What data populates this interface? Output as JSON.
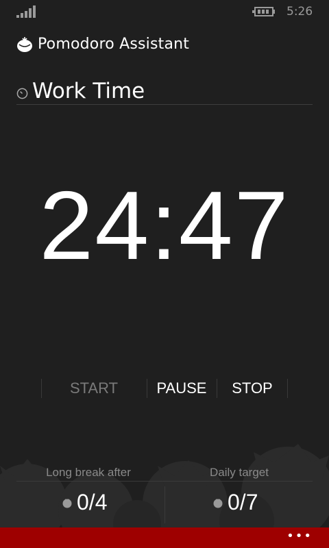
{
  "status_bar": {
    "time": "5:26",
    "icons": [
      "signal-icon",
      "battery-charging-icon"
    ]
  },
  "header": {
    "app_title": "Pomodoro Assistant",
    "icon": "tomato-logo-icon"
  },
  "section": {
    "title": "Work Time",
    "icon": "clock-icon"
  },
  "timer": {
    "display": "24:47"
  },
  "controls": {
    "start_label": "START",
    "pause_label": "PAUSE",
    "stop_label": "STOP"
  },
  "stats": {
    "long_break": {
      "label": "Long break after",
      "value": "0/4"
    },
    "daily_target": {
      "label": "Daily target",
      "value": "0/7"
    }
  },
  "app_bar": {
    "more_label": "•••"
  },
  "colors": {
    "background": "#1f1f1f",
    "accent": "#9e0000",
    "disabled_text": "#7a7a7a",
    "muted_text": "#8a8a8a"
  }
}
